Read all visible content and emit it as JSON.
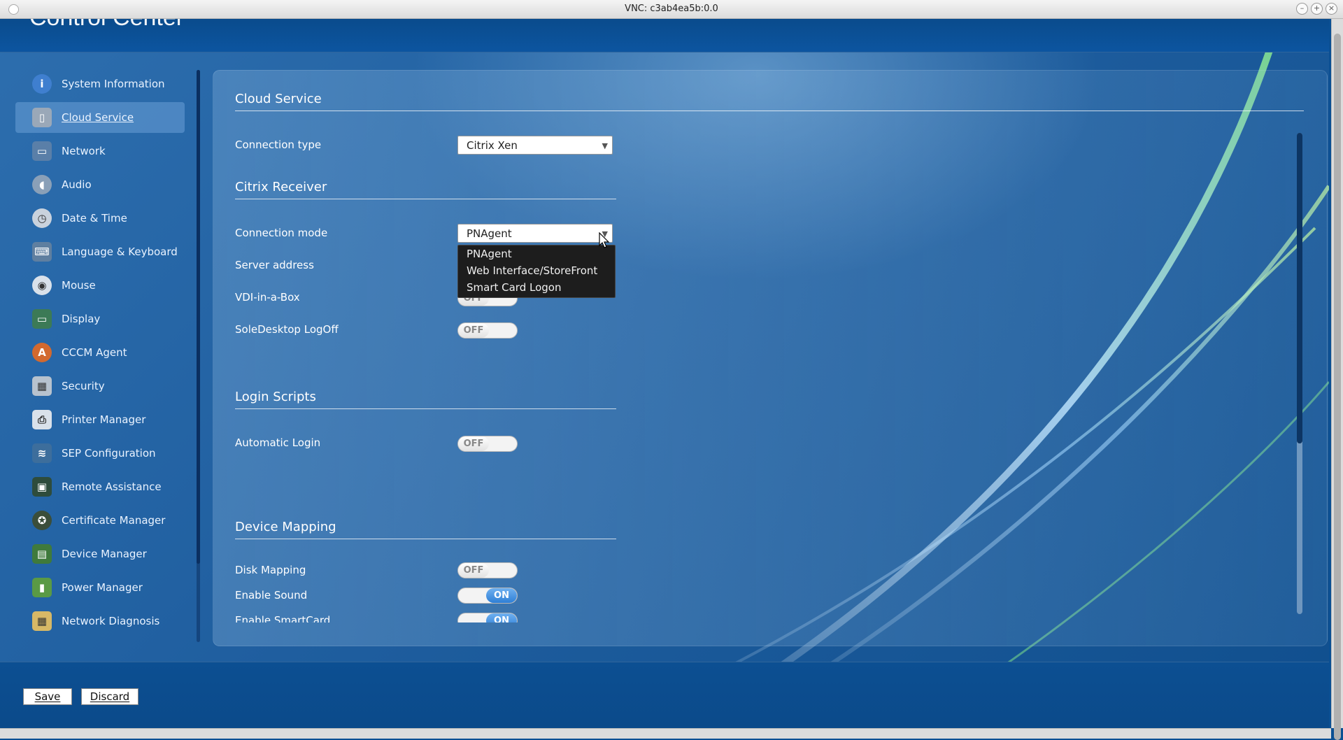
{
  "window": {
    "title": "VNC: c3ab4ea5b:0.0",
    "controls": [
      "–",
      "+",
      "×"
    ]
  },
  "app": {
    "title": "Control Center"
  },
  "sidebar": {
    "items": [
      {
        "label": "System Information",
        "icon": "info-icon",
        "color": "#3f7fcf"
      },
      {
        "label": "Cloud Service",
        "icon": "cloud-server-icon",
        "color": "#9aa8b8",
        "active": true
      },
      {
        "label": "Network",
        "icon": "network-icon",
        "color": "#5a7fa8"
      },
      {
        "label": "Audio",
        "icon": "speaker-icon",
        "color": "#8aa0b8"
      },
      {
        "label": "Date & Time",
        "icon": "clock-icon",
        "color": "#c9d2dd"
      },
      {
        "label": "Language & Keyboard",
        "icon": "keyboard-icon",
        "color": "#5f7fa0"
      },
      {
        "label": "Mouse",
        "icon": "mouse-icon",
        "color": "#d9e1ea"
      },
      {
        "label": "Display",
        "icon": "display-icon",
        "color": "#3c7a56"
      },
      {
        "label": "CCCM Agent",
        "icon": "agent-icon",
        "color": "#d2692f"
      },
      {
        "label": "Security",
        "icon": "security-icon",
        "color": "#b7c2ce"
      },
      {
        "label": "Printer Manager",
        "icon": "printer-icon",
        "color": "#d9e1ea"
      },
      {
        "label": "SEP Configuration",
        "icon": "sep-icon",
        "color": "#3d6e9c"
      },
      {
        "label": "Remote Assistance",
        "icon": "remote-assistance-icon",
        "color": "#2e4c3c"
      },
      {
        "label": "Certificate Manager",
        "icon": "certificate-icon",
        "color": "#3b4e3a"
      },
      {
        "label": "Device Manager",
        "icon": "device-icon",
        "color": "#3f7a3c"
      },
      {
        "label": "Power Manager",
        "icon": "battery-icon",
        "color": "#5a9a45"
      },
      {
        "label": "Network Diagnosis",
        "icon": "diagnosis-icon",
        "color": "#d7b866"
      }
    ]
  },
  "main": {
    "cloud_service": {
      "title": "Cloud Service",
      "connection_type_label": "Connection type",
      "connection_type_value": "Citrix Xen"
    },
    "citrix_receiver": {
      "title": "Citrix Receiver",
      "connection_mode_label": "Connection mode",
      "connection_mode_value": "PNAgent",
      "connection_mode_options": [
        "PNAgent",
        "Web Interface/StoreFront",
        "Smart Card Logon"
      ],
      "server_address_label": "Server address",
      "vdi_label": "VDI-in-a-Box",
      "vdi_value": "OFF",
      "soledesktop_label": "SoleDesktop LogOff",
      "soledesktop_value": "OFF"
    },
    "login_scripts": {
      "title": "Login Scripts",
      "automatic_login_label": "Automatic Login",
      "automatic_login_value": "OFF"
    },
    "device_mapping": {
      "title": "Device Mapping",
      "disk_mapping_label": "Disk Mapping",
      "disk_mapping_value": "OFF",
      "enable_sound_label": "Enable Sound",
      "enable_sound_value": "ON",
      "enable_smartcard_label": "Enable SmartCard",
      "enable_smartcard_value": "ON"
    }
  },
  "footer": {
    "save_label": "Save",
    "discard_label": "Discard"
  }
}
